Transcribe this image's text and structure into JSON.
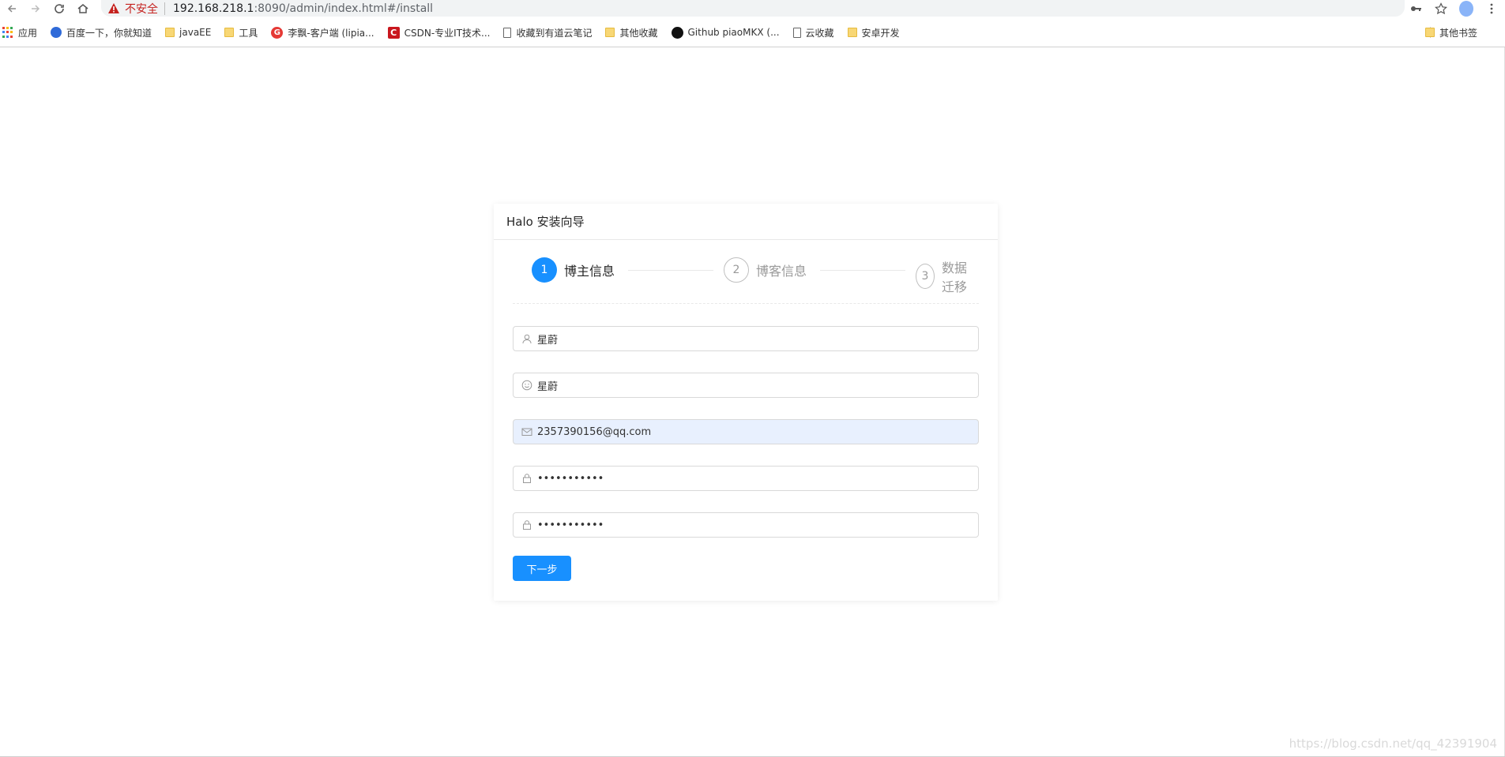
{
  "browser": {
    "security_label": "不安全",
    "url_host": "192.168.218.1",
    "url_rest": ":8090/admin/index.html#/install",
    "bookmarks": [
      {
        "label": "应用",
        "icon": "apps-grid-icon"
      },
      {
        "label": "百度一下，你就知道",
        "icon": "baidu-icon"
      },
      {
        "label": "javaEE",
        "icon": "folder-icon"
      },
      {
        "label": "工具",
        "icon": "folder-icon"
      },
      {
        "label": "李飘-客户端 (lipia...",
        "icon": "gitee-icon"
      },
      {
        "label": "CSDN-专业IT技术...",
        "icon": "csdn-icon"
      },
      {
        "label": "收藏到有道云笔记",
        "icon": "document-icon"
      },
      {
        "label": "其他收藏",
        "icon": "folder-icon"
      },
      {
        "label": "Github piaoMKX (...",
        "icon": "github-icon"
      },
      {
        "label": "云收藏",
        "icon": "document-icon"
      },
      {
        "label": "安卓开发",
        "icon": "folder-icon"
      }
    ],
    "other_bookmarks": "其他书签"
  },
  "wizard": {
    "title": "Halo 安装向导",
    "steps": [
      {
        "num": "1",
        "title": "博主信息",
        "status": "active"
      },
      {
        "num": "2",
        "title": "博客信息",
        "status": "wait"
      },
      {
        "num": "3",
        "title": "数据迁移",
        "status": "wait"
      }
    ],
    "fields": {
      "username": "星蔚",
      "nickname": "星蔚",
      "email": "2357390156@qq.com",
      "password": "•••••••••••",
      "confirm_password": "•••••••••••"
    },
    "next_label": "下一步"
  },
  "watermark": "https://blog.csdn.net/qq_42391904",
  "colors": {
    "primary": "#1890ff",
    "insecure": "#c5221f",
    "autofill": "#e8f0fe"
  }
}
